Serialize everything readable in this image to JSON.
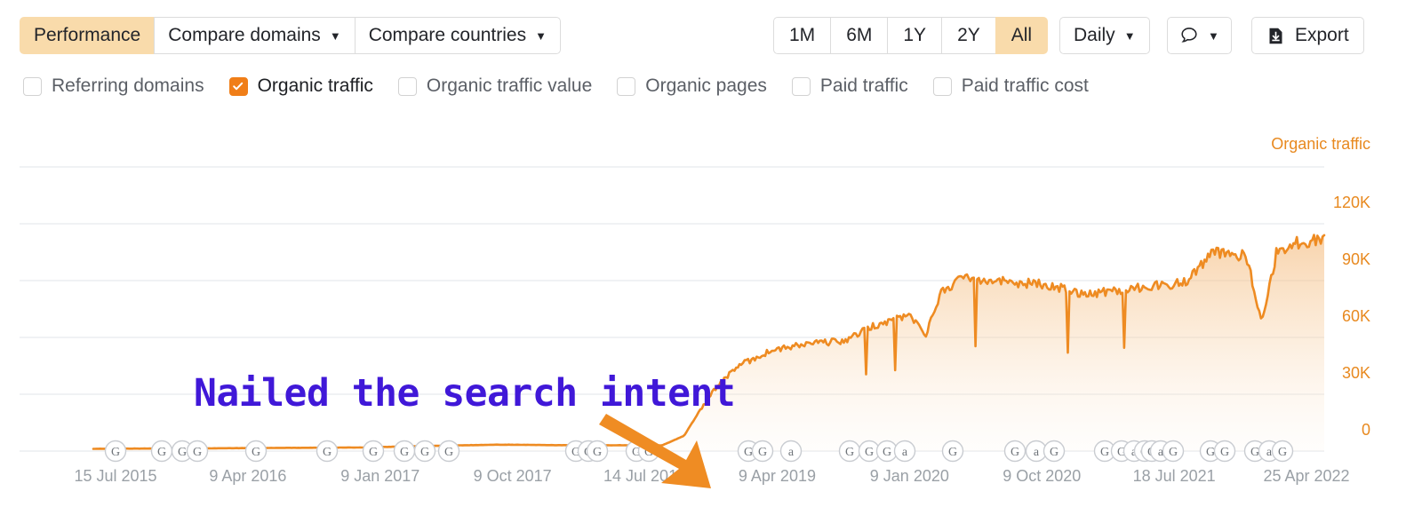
{
  "toolbar": {
    "tabs": [
      {
        "label": "Performance",
        "active": true,
        "caret": false
      },
      {
        "label": "Compare domains",
        "active": false,
        "caret": true
      },
      {
        "label": "Compare countries",
        "active": false,
        "caret": true
      }
    ],
    "ranges": [
      {
        "label": "1M",
        "active": false
      },
      {
        "label": "6M",
        "active": false
      },
      {
        "label": "1Y",
        "active": false
      },
      {
        "label": "2Y",
        "active": false
      },
      {
        "label": "All",
        "active": true
      }
    ],
    "granularity": {
      "label": "Daily",
      "caret": "▼"
    },
    "annotations_button": {
      "icon": "comment-icon",
      "caret": "▼"
    },
    "export": {
      "label": "Export",
      "icon": "download-icon"
    },
    "caret_glyph": "▼"
  },
  "metrics": [
    {
      "label": "Referring domains",
      "checked": false
    },
    {
      "label": "Organic traffic",
      "checked": true
    },
    {
      "label": "Organic traffic value",
      "checked": false
    },
    {
      "label": "Organic pages",
      "checked": false
    },
    {
      "label": "Paid traffic",
      "checked": false
    },
    {
      "label": "Paid traffic cost",
      "checked": false
    }
  ],
  "annotation": {
    "text": "Nailed the search intent",
    "color": "#4018d8",
    "arrow_color": "#ef8c23"
  },
  "colors": {
    "accent": "#f07e18",
    "line": "#ee8b22",
    "axis_label": "#e8891f",
    "tick_label": "#9aa0a6",
    "grid": "#eceef0",
    "tab_active_bg": "#f9dbab"
  },
  "chart_data": {
    "type": "area",
    "title": "",
    "series_name": "Organic traffic",
    "ylabel": "Organic traffic",
    "xlabel": "",
    "ylim": [
      0,
      150000
    ],
    "yticks": [
      0,
      30000,
      60000,
      90000,
      120000
    ],
    "ytick_labels": [
      "0",
      "30K",
      "60K",
      "90K",
      "120K"
    ],
    "grid": true,
    "legend_position": "top-right",
    "xtick_labels": [
      "15 Jul 2015",
      "9 Apr 2016",
      "9 Jan 2017",
      "9 Oct 2017",
      "14 Jul 2018",
      "9 Apr 2019",
      "9 Jan 2020",
      "9 Oct 2020",
      "18 Jul 2021",
      "25 Apr 2022"
    ],
    "x_start": "15 Jul 2015",
    "x_end": "25 Apr 2022",
    "points": [
      {
        "x": "2015-07-15",
        "y": 1200
      },
      {
        "x": "2015-10-01",
        "y": 1300
      },
      {
        "x": "2016-01-01",
        "y": 1400
      },
      {
        "x": "2016-04-09",
        "y": 1500
      },
      {
        "x": "2016-08-01",
        "y": 1700
      },
      {
        "x": "2017-01-09",
        "y": 1900
      },
      {
        "x": "2017-05-01",
        "y": 2600
      },
      {
        "x": "2017-10-09",
        "y": 3400
      },
      {
        "x": "2018-01-01",
        "y": 3200
      },
      {
        "x": "2018-04-01",
        "y": 3000
      },
      {
        "x": "2018-07-14",
        "y": 3100
      },
      {
        "x": "2018-09-01",
        "y": 3000
      },
      {
        "x": "2018-10-15",
        "y": 8000
      },
      {
        "x": "2018-11-15",
        "y": 21000
      },
      {
        "x": "2018-12-20",
        "y": 34000
      },
      {
        "x": "2019-02-01",
        "y": 45000
      },
      {
        "x": "2019-04-09",
        "y": 53000
      },
      {
        "x": "2019-07-01",
        "y": 57000
      },
      {
        "x": "2019-09-01",
        "y": 58000
      },
      {
        "x": "2019-11-01",
        "y": 66000
      },
      {
        "x": "2020-01-09",
        "y": 72000
      },
      {
        "x": "2020-02-15",
        "y": 62000
      },
      {
        "x": "2020-03-15",
        "y": 84000
      },
      {
        "x": "2020-05-01",
        "y": 92000
      },
      {
        "x": "2020-07-01",
        "y": 90000
      },
      {
        "x": "2020-10-09",
        "y": 88000
      },
      {
        "x": "2021-01-01",
        "y": 83000
      },
      {
        "x": "2021-04-01",
        "y": 86000
      },
      {
        "x": "2021-07-18",
        "y": 89000
      },
      {
        "x": "2021-09-15",
        "y": 105000
      },
      {
        "x": "2021-11-20",
        "y": 103000
      },
      {
        "x": "2021-12-20",
        "y": 67000
      },
      {
        "x": "2022-01-20",
        "y": 106000
      },
      {
        "x": "2022-03-01",
        "y": 110000
      },
      {
        "x": "2022-04-25",
        "y": 112000
      }
    ],
    "peak_value": 112000,
    "min_value": 1200,
    "event_markers": [
      {
        "label": "G"
      },
      {
        "label": "G"
      },
      {
        "label": "G"
      },
      {
        "label": "G"
      },
      {
        "label": "G"
      },
      {
        "label": "G"
      },
      {
        "label": "G"
      },
      {
        "label": "G"
      },
      {
        "label": "G"
      },
      {
        "label": "a"
      }
    ]
  }
}
